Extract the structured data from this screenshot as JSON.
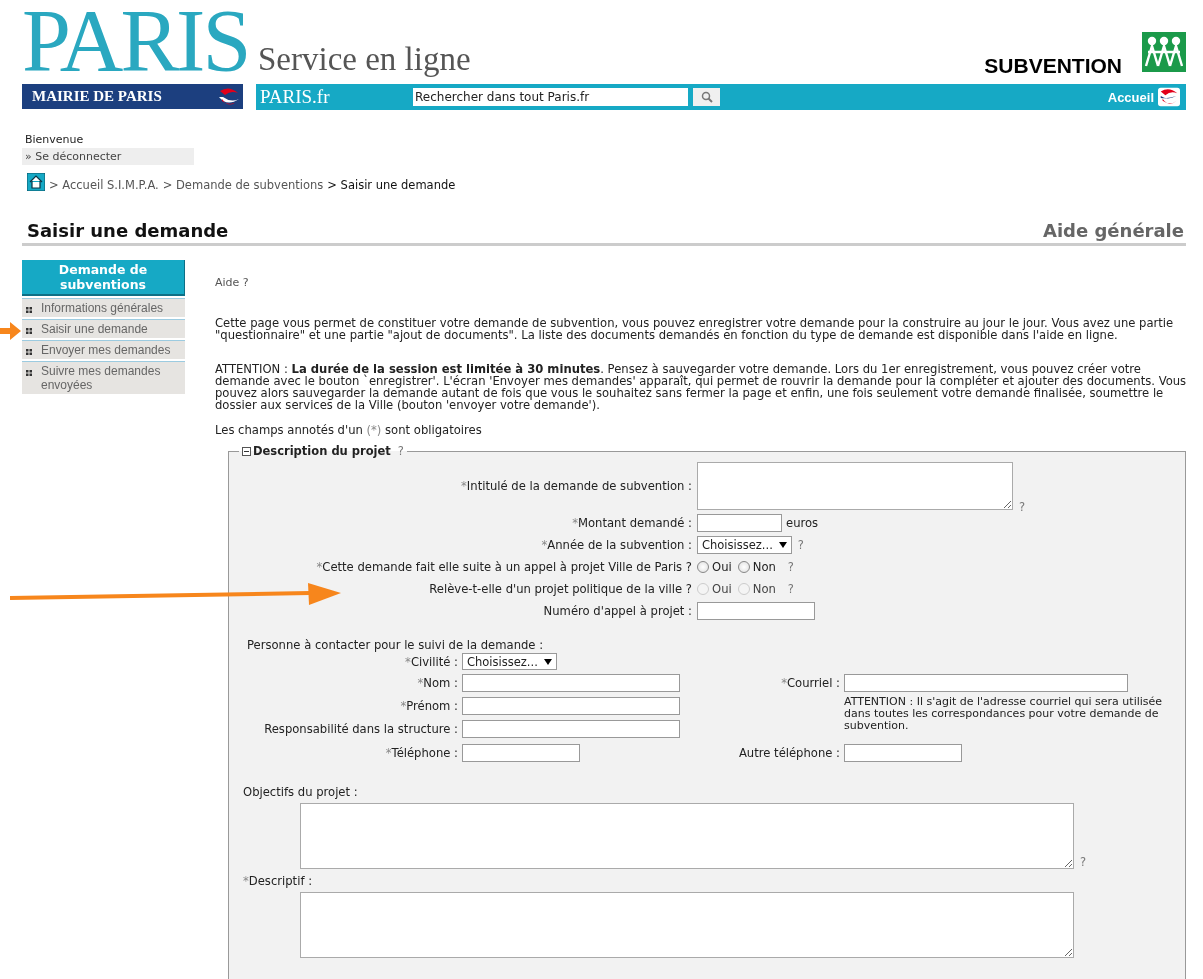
{
  "header": {
    "logo": "PARIS",
    "service": "Service en ligne",
    "mairie": "MAIRIE DE PARIS",
    "parisfr": "PARIS.fr",
    "search": {
      "value": "Rechercher dans tout Paris.fr"
    },
    "home": "Accueil",
    "product": "SUBVENTION"
  },
  "user": {
    "greeting": "Bienvenue",
    "logout": "» Se déconnecter"
  },
  "breadcrumb": [
    {
      "label": "> Accueil S.I.M.P.A.",
      "current": false
    },
    {
      "label": "> Demande de subventions",
      "current": false
    },
    {
      "label": "> Saisir une demande",
      "current": true
    }
  ],
  "page_title": "Saisir une demande",
  "help_link": "Aide générale",
  "sidebar": {
    "title": "Demande de subventions",
    "items": [
      "Informations générales",
      "Saisir une demande",
      "Envoyer mes demandes",
      "Suivre mes demandes envoyées"
    ]
  },
  "intro": {
    "help": "Aide ?",
    "paragraphs": [
      "Cette page vous permet de constituer votre demande de subvention, vous pouvez enregistrer votre demande pour la construire au jour le jour. Vous avez une partie \"questionnaire\" et une partie \"ajout de documents\". La liste des documents demandés en fonction du type de demande est disponible dans l'aide en ligne.",
      "ATTENTION : **La durée de la session est limitée à 30 minutes**. Pensez à sauvegarder votre demande. Lors du 1er enregistrement, vous pouvez créer votre demande avec le bouton `enregistrer'. L'écran 'Envoyer mes demandes' apparaît, qui permet de rouvrir la demande pour la compléter et ajouter des documents. Vous pouvez alors sauvegarder la demande autant de fois que vous le souhaitez sans fermer la page et enfin, une fois seulement votre demande finalisée, soumettre le dossier aux services de la Ville (bouton 'envoyer votre demande')."
    ],
    "required_note": {
      "before": "Les champs annotés d'un ",
      "mark": "(*)",
      "after": " sont obligatoires"
    }
  },
  "fieldset": {
    "legend": "Description du projet",
    "help": "?",
    "fields": [
      {
        "kind": "textarea",
        "mark": "*",
        "label": "Intitulé de la demande de subvention :",
        "help": "?"
      },
      {
        "kind": "text",
        "mark": "*",
        "label": "Montant demandé :",
        "suffix": "euros"
      },
      {
        "kind": "select",
        "mark": "*",
        "label": "Année de la subvention :",
        "value": "Choisissez...",
        "help": "?"
      },
      {
        "kind": "radio",
        "mark": "*",
        "label": "Cette demande fait elle suite à un appel à projet Ville de Paris ?",
        "disabled": false,
        "options": [
          {
            "label": "Oui",
            "selected": false
          },
          {
            "label": "Non",
            "selected": false
          }
        ],
        "help": "?"
      },
      {
        "kind": "radio",
        "label": "Relève-t-elle d'un projet politique de la ville ?",
        "disabled": true,
        "options": [
          {
            "label": "Oui",
            "selected": false
          },
          {
            "label": "Non",
            "selected": false
          }
        ],
        "help": "?"
      },
      {
        "kind": "text",
        "label": "Numéro d'appel à projet :"
      }
    ],
    "contact": {
      "title": "Personne à contacter pour le suivi de la demande :",
      "civility": {
        "mark": "*",
        "label": "Civilité :",
        "value": "Choisissez..."
      },
      "name": {
        "mark": "*",
        "label": "Nom :"
      },
      "firstname": {
        "mark": "*",
        "label": "Prénom :"
      },
      "role": {
        "label": "Responsabilité dans la structure :"
      },
      "phone": {
        "mark": "*",
        "label": "Téléphone :"
      },
      "email": {
        "mark": "*",
        "label": "Courriel :"
      },
      "email_note": "ATTENTION : Il s'agit de l'adresse courriel qui sera utilisée dans toutes les correspondances pour votre demande de subvention.",
      "phone2": {
        "label": "Autre téléphone :"
      }
    },
    "objectives": {
      "label": "Objectifs du projet :",
      "help": "?"
    },
    "description": {
      "mark": "*",
      "label": "Descriptif :"
    }
  }
}
